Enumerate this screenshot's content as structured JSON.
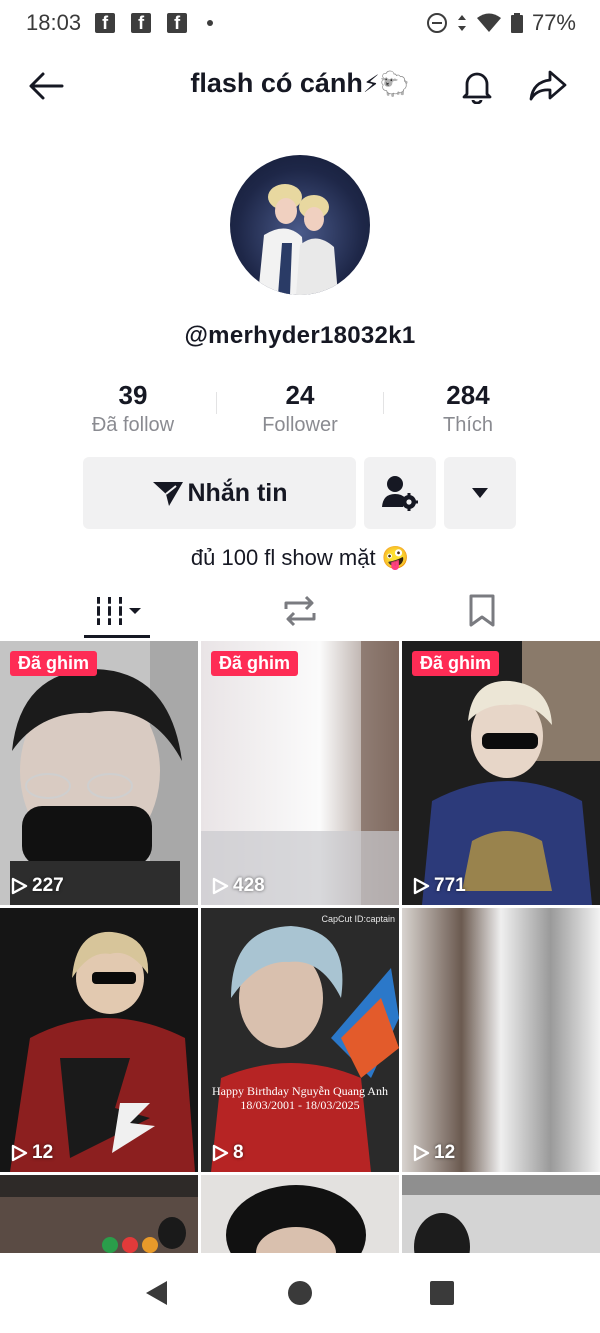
{
  "status_bar": {
    "time": "18:03",
    "fb_badges": [
      "f",
      "f",
      "f"
    ],
    "battery": "77%"
  },
  "header": {
    "title": "flash có cánh",
    "title_emoji": "⚡🐑"
  },
  "profile": {
    "username": "@merhyder18032k1",
    "stats": [
      {
        "value": "39",
        "label": "Đã follow"
      },
      {
        "value": "24",
        "label": "Follower"
      },
      {
        "value": "284",
        "label": "Thích"
      }
    ],
    "message_button": "Nhắn tin",
    "bio": "đủ 100 fl show mặt 🤪"
  },
  "tabs": [
    {
      "name": "videos",
      "icon": "grid-icon",
      "active": true
    },
    {
      "name": "reposts",
      "icon": "repost-icon",
      "active": false
    },
    {
      "name": "saved",
      "icon": "bookmark-icon",
      "active": false
    }
  ],
  "videos": [
    {
      "pinned": true,
      "pin_label": "Đã ghim",
      "views": "227"
    },
    {
      "pinned": true,
      "pin_label": "Đã ghim",
      "views": "428"
    },
    {
      "pinned": true,
      "pin_label": "Đã ghim",
      "views": "771"
    },
    {
      "pinned": false,
      "views": "12"
    },
    {
      "pinned": false,
      "views": "8",
      "overlay_line1": "Happy Birthday Nguyễn Quang Anh",
      "overlay_line2": "18/03/2001 - 18/03/2025",
      "watermark": "CapCut ID:captain"
    },
    {
      "pinned": false,
      "views": "12"
    }
  ],
  "colors": {
    "accent": "#fe2c55",
    "button_bg": "#f1f1f2",
    "text": "#161823",
    "muted": "#8a8b91"
  }
}
